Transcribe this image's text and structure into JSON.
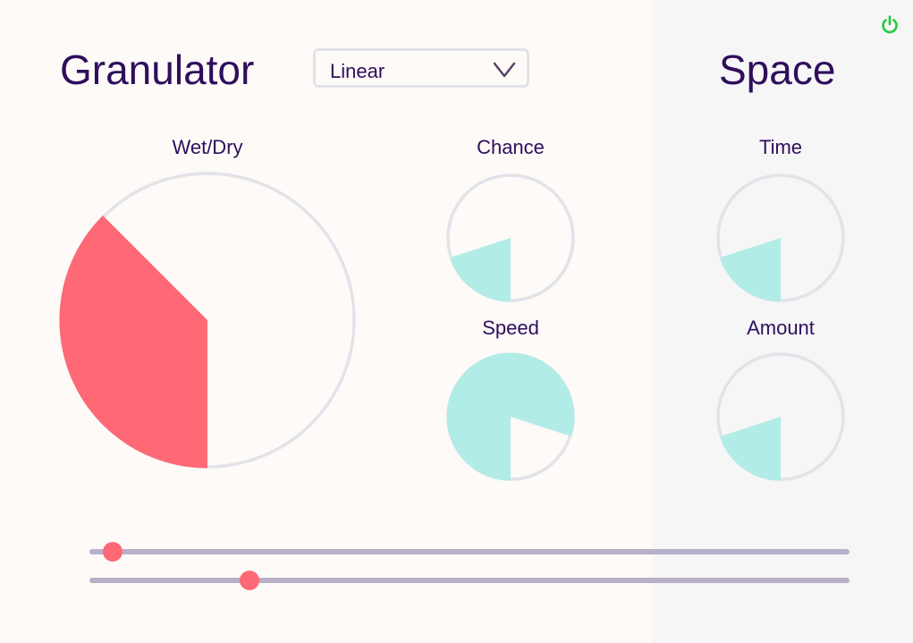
{
  "granulator": {
    "title": "Granulator",
    "mode_select": {
      "value": "Linear"
    },
    "knobs": {
      "wet_dry": {
        "label": "Wet/Dry",
        "value": 0.375,
        "color": "#ff6875"
      },
      "chance": {
        "label": "Chance",
        "value": 0.2,
        "color": "#b2ece7"
      },
      "speed": {
        "label": "Speed",
        "value": 0.8,
        "color": "#b2ece7"
      }
    }
  },
  "space": {
    "title": "Space",
    "knobs": {
      "time": {
        "label": "Time",
        "value": 0.2,
        "color": "#b2ece7"
      },
      "amount": {
        "label": "Amount",
        "value": 0.2,
        "color": "#b2ece7"
      }
    }
  },
  "sliders": [
    {
      "value": 0.03
    },
    {
      "value": 0.21
    }
  ],
  "colors": {
    "text": "#2f0e5c",
    "ring": "#e2e3e8",
    "track": "#b8afc9",
    "thumb": "#ff6875",
    "power": "#23c93d",
    "panel_left": "#fdfaf8",
    "panel_right": "#f6f6f7"
  },
  "icons": {
    "power": "power-icon",
    "dropdown": "chevron-down-icon"
  }
}
